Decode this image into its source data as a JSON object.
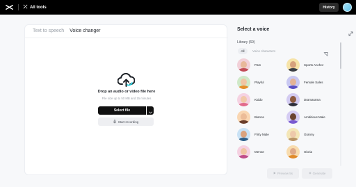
{
  "topbar": {
    "logo_icon": "capcut-logo-icon",
    "all_tools_icon": "tools-icon",
    "all_tools_label": "All tools",
    "history_label": "History"
  },
  "tabs": [
    {
      "label": "Text to speech",
      "active": false
    },
    {
      "label": "Voice changer",
      "active": true
    }
  ],
  "upload": {
    "icon": "cloud-upload-icon",
    "title": "Drop an audio or video file here",
    "subtitle": "File size up to 50 MB and 15 minutes",
    "select_label": "Select file",
    "record_label": "Start recording",
    "record_icon": "microphone-icon"
  },
  "voice_panel": {
    "title": "Select a voice",
    "library_label": "Library (69)",
    "filter_all": "All",
    "filter_voice_characters": "Voice characters",
    "voices": [
      {
        "name": "Pam",
        "bg": "#f2d0d8",
        "skin": "#e8b89a",
        "shirt": "#c24d58"
      },
      {
        "name": "Sports Anchor",
        "bg": "#f6e3a8",
        "skin": "#d6a17c",
        "shirt": "#3b3f46"
      },
      {
        "name": "Playful",
        "bg": "#cfe9c8",
        "skin": "#f0c5a3",
        "shirt": "#e58f2b"
      },
      {
        "name": "Female Sales",
        "bg": "#c9c8f1",
        "skin": "#e4b396",
        "shirt": "#5a4fc4"
      },
      {
        "name": "Kiddo",
        "bg": "#f5d2e2",
        "skin": "#f1c8a8",
        "shirt": "#e26a8c"
      },
      {
        "name": "Dramarama",
        "bg": "#d3cbf1",
        "skin": "#8c5a3e",
        "shirt": "#2f2f3a"
      },
      {
        "name": "Bianca",
        "bg": "#f9d6b2",
        "skin": "#ecbc98",
        "shirt": "#6a3d2a"
      },
      {
        "name": "Ambitious Male",
        "bg": "#d5ccf3",
        "skin": "#6b4330",
        "shirt": "#7a5bd1"
      },
      {
        "name": "Flirty Male",
        "bg": "#c9e2f5",
        "skin": "#d9a27e",
        "shirt": "#2d5f8a"
      },
      {
        "name": "Granny",
        "bg": "#f4e6b7",
        "skin": "#eec9aa",
        "shirt": "#b99466"
      },
      {
        "name": "Mentor",
        "bg": "#f5d1e1",
        "skin": "#efc3a2",
        "shirt": "#c04d8a"
      },
      {
        "name": "Gloria",
        "bg": "#f8dcae",
        "skin": "#dfa987",
        "shirt": "#e08a2a"
      }
    ]
  },
  "actions": {
    "preview_label": "Preview 5s",
    "preview_icon": "play-icon",
    "generate_label": "Generate",
    "generate_icon": "sparkle-icon"
  },
  "colors": {
    "topbar": "#000000",
    "primary_button": "#111111",
    "disabled_button": "#eeeff2",
    "upload_icon_accent": "#19d3e2"
  }
}
